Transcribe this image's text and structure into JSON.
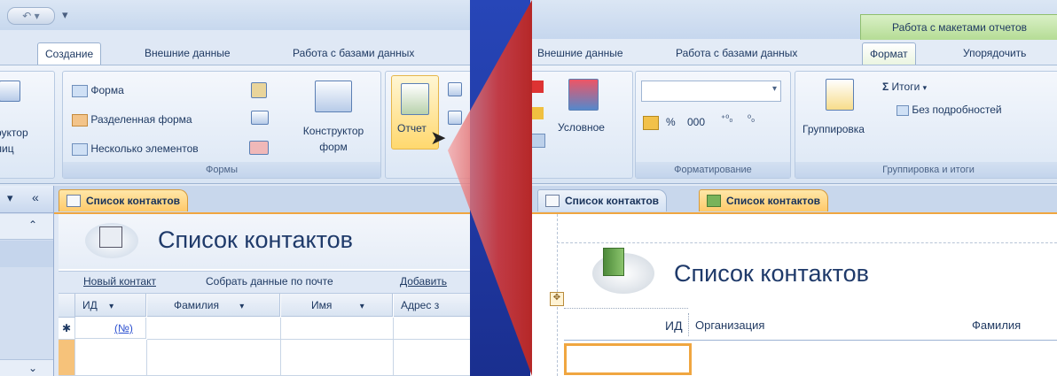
{
  "left": {
    "tabs": [
      "Создание",
      "Внешние данные",
      "Работа с базами данных"
    ],
    "ribbon": {
      "table_partial": "руктор",
      "table_partial2": "лиц",
      "forms": [
        "Форма",
        "Разделенная форма",
        "Несколько элементов"
      ],
      "form_designer_line1": "Конструктор",
      "form_designer_line2": "форм",
      "forms_group": "Формы",
      "report_button": "Отчет"
    },
    "doc_tab": "Список контактов",
    "nav_hdr_left": "▾",
    "nav_hdr_right": "«",
    "nav_up": "⌃",
    "nav_down": "⌄",
    "form_title": "Список контактов",
    "links": [
      "Новый контакт",
      "Собрать данные по почте",
      "Добавить"
    ],
    "grid_headers": [
      "ИД",
      "Фамилия",
      "Имя",
      "Адрес з"
    ],
    "new_row_marker": "✱",
    "new_row_id": "(№)"
  },
  "right": {
    "context_title": "Работа с макетами отчетов",
    "tabs": [
      "Внешние данные",
      "Работа с базами данных",
      "Формат",
      "Упорядочить"
    ],
    "conditional": "Условное",
    "number_format": [
      "%",
      "000",
      "‰"
    ],
    "formatting_group": "Форматирование",
    "grouping_button": "Группировка",
    "totals": "Итоги",
    "no_details": "Без подробностей",
    "grouping_group": "Группировка и итоги",
    "doc_tabs": [
      "Список контактов",
      "Список контактов"
    ],
    "report_title": "Список контактов",
    "columns": [
      "ИД",
      "Организация",
      "Фамилия"
    ]
  },
  "colors": {
    "background": "#2746b8",
    "arrow": "#d23b3b",
    "active_tab": "#ffc96a"
  }
}
